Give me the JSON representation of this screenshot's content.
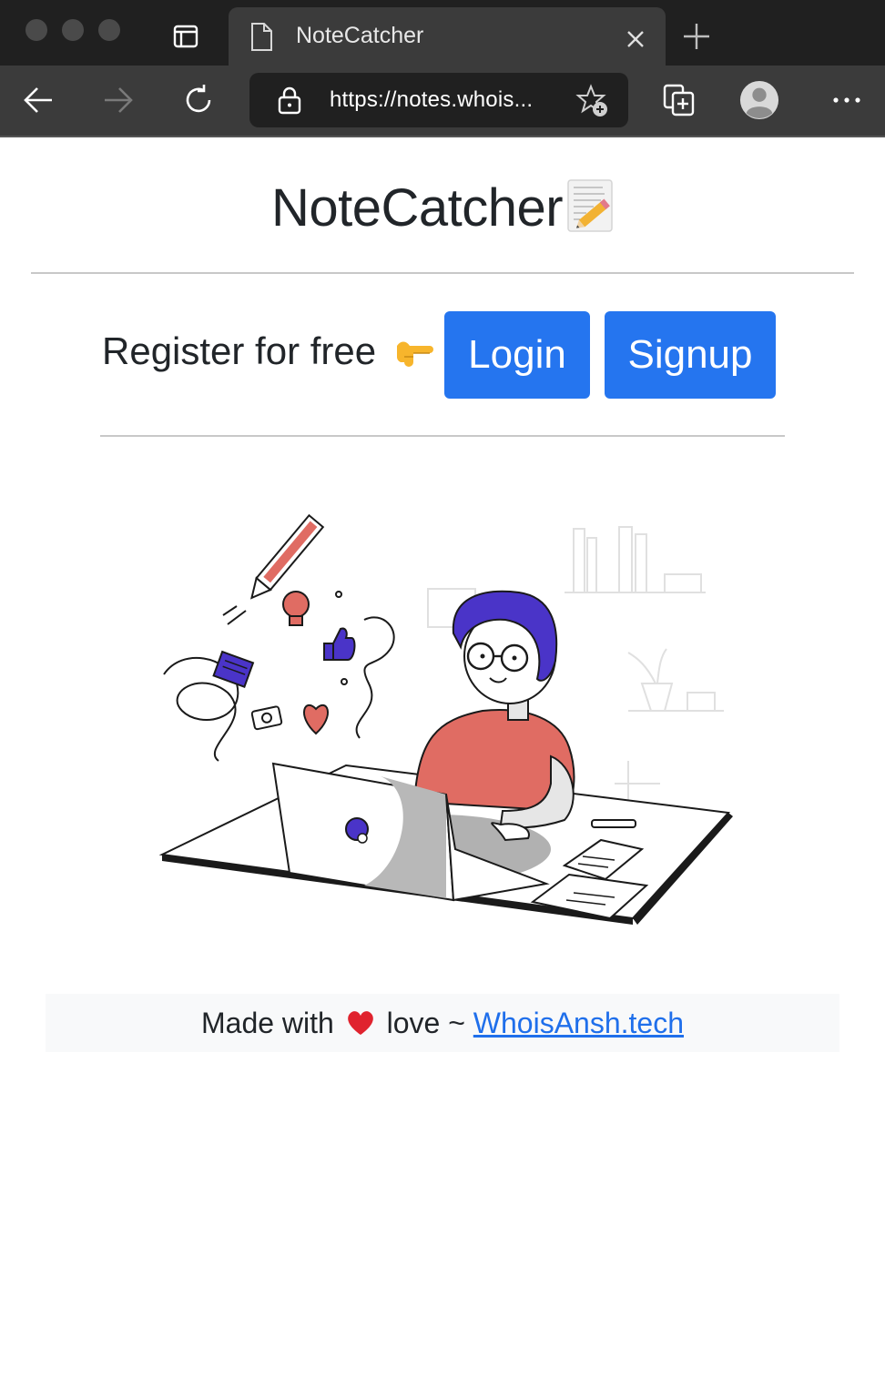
{
  "browser": {
    "tab_title": "NoteCatcher",
    "url_scheme": "https://",
    "url_rest": "notes.whois..."
  },
  "page": {
    "title": "NoteCatcher",
    "register_text": "Register for free",
    "login_label": "Login",
    "signup_label": "Signup",
    "footer_prefix": "Made with",
    "footer_middle": "love ~",
    "footer_link": "WhoisAnsh.tech"
  },
  "colors": {
    "accent": "#2575ef",
    "chrome_dark": "#202020",
    "chrome_mid": "#3b3b3b",
    "illustration_red": "#e06c63",
    "illustration_purple": "#4a34c8"
  },
  "icons": {
    "title_emoji": "memo-icon",
    "pointing": "pointing-right-icon",
    "heart": "red-heart-icon"
  }
}
